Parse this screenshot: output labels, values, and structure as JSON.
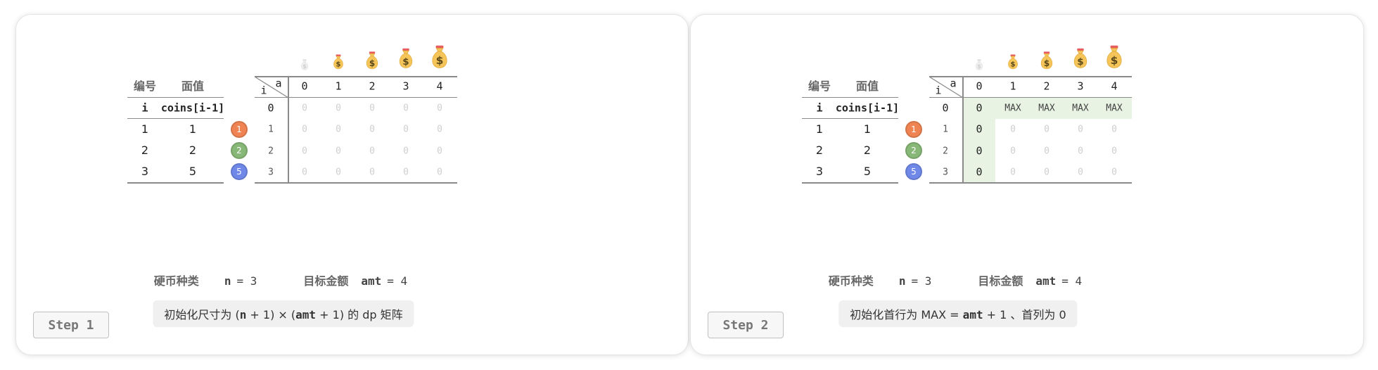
{
  "panels": [
    {
      "step_label": "Step 1",
      "table_left": {
        "headers": [
          "编号",
          "面值"
        ],
        "subheaders": [
          "i",
          "coins[i-1]"
        ],
        "rows": [
          [
            "1",
            "1"
          ],
          [
            "2",
            "2"
          ],
          [
            "3",
            "5"
          ]
        ]
      },
      "coin_badges": [
        {
          "label": "1",
          "color": "#ef8452"
        },
        {
          "label": "2",
          "color": "#88b877"
        },
        {
          "label": "5",
          "color": "#7089e8"
        }
      ],
      "dp": {
        "corner_row": "i",
        "corner_col": "a",
        "col_headers": [
          "0",
          "1",
          "2",
          "3",
          "4"
        ],
        "row_headers": [
          "0",
          "1",
          "2",
          "3"
        ],
        "cells": [
          [
            "0",
            "0",
            "0",
            "0",
            "0"
          ],
          [
            "0",
            "0",
            "0",
            "0",
            "0"
          ],
          [
            "0",
            "0",
            "0",
            "0",
            "0"
          ],
          [
            "0",
            "0",
            "0",
            "0",
            "0"
          ]
        ],
        "highlight_first_row": false,
        "highlight_first_col": false
      },
      "info": {
        "kinds_label": "硬币种类",
        "n_var": "n",
        "n_eq": "= 3",
        "target_label": "目标金额",
        "amt_var": "amt",
        "amt_eq": "= 4"
      },
      "caption": {
        "p1": "初始化尺寸为 (",
        "v1": "n",
        "p2": " + 1) × (",
        "v2": "amt",
        "p3": " + 1) 的 dp 矩阵"
      }
    },
    {
      "step_label": "Step 2",
      "table_left": {
        "headers": [
          "编号",
          "面值"
        ],
        "subheaders": [
          "i",
          "coins[i-1]"
        ],
        "rows": [
          [
            "1",
            "1"
          ],
          [
            "2",
            "2"
          ],
          [
            "3",
            "5"
          ]
        ]
      },
      "coin_badges": [
        {
          "label": "1",
          "color": "#ef8452"
        },
        {
          "label": "2",
          "color": "#88b877"
        },
        {
          "label": "5",
          "color": "#7089e8"
        }
      ],
      "dp": {
        "corner_row": "i",
        "corner_col": "a",
        "col_headers": [
          "0",
          "1",
          "2",
          "3",
          "4"
        ],
        "row_headers": [
          "0",
          "1",
          "2",
          "3"
        ],
        "cells": [
          [
            "0",
            "MAX",
            "MAX",
            "MAX",
            "MAX"
          ],
          [
            "0",
            "0",
            "0",
            "0",
            "0"
          ],
          [
            "0",
            "0",
            "0",
            "0",
            "0"
          ],
          [
            "0",
            "0",
            "0",
            "0",
            "0"
          ]
        ],
        "highlight_first_row": true,
        "highlight_first_col": true
      },
      "info": {
        "kinds_label": "硬币种类",
        "n_var": "n",
        "n_eq": "= 3",
        "target_label": "目标金额",
        "amt_var": "amt",
        "amt_eq": "= 4"
      },
      "caption": {
        "p1": "初始化首行为 MAX = ",
        "v1": "amt",
        "p2": " + 1 、首列为 0"
      }
    }
  ],
  "colors": {
    "highlight": "#e8f3e3",
    "bag": "#f6c55a",
    "grid_line": "#8a8a8a"
  }
}
